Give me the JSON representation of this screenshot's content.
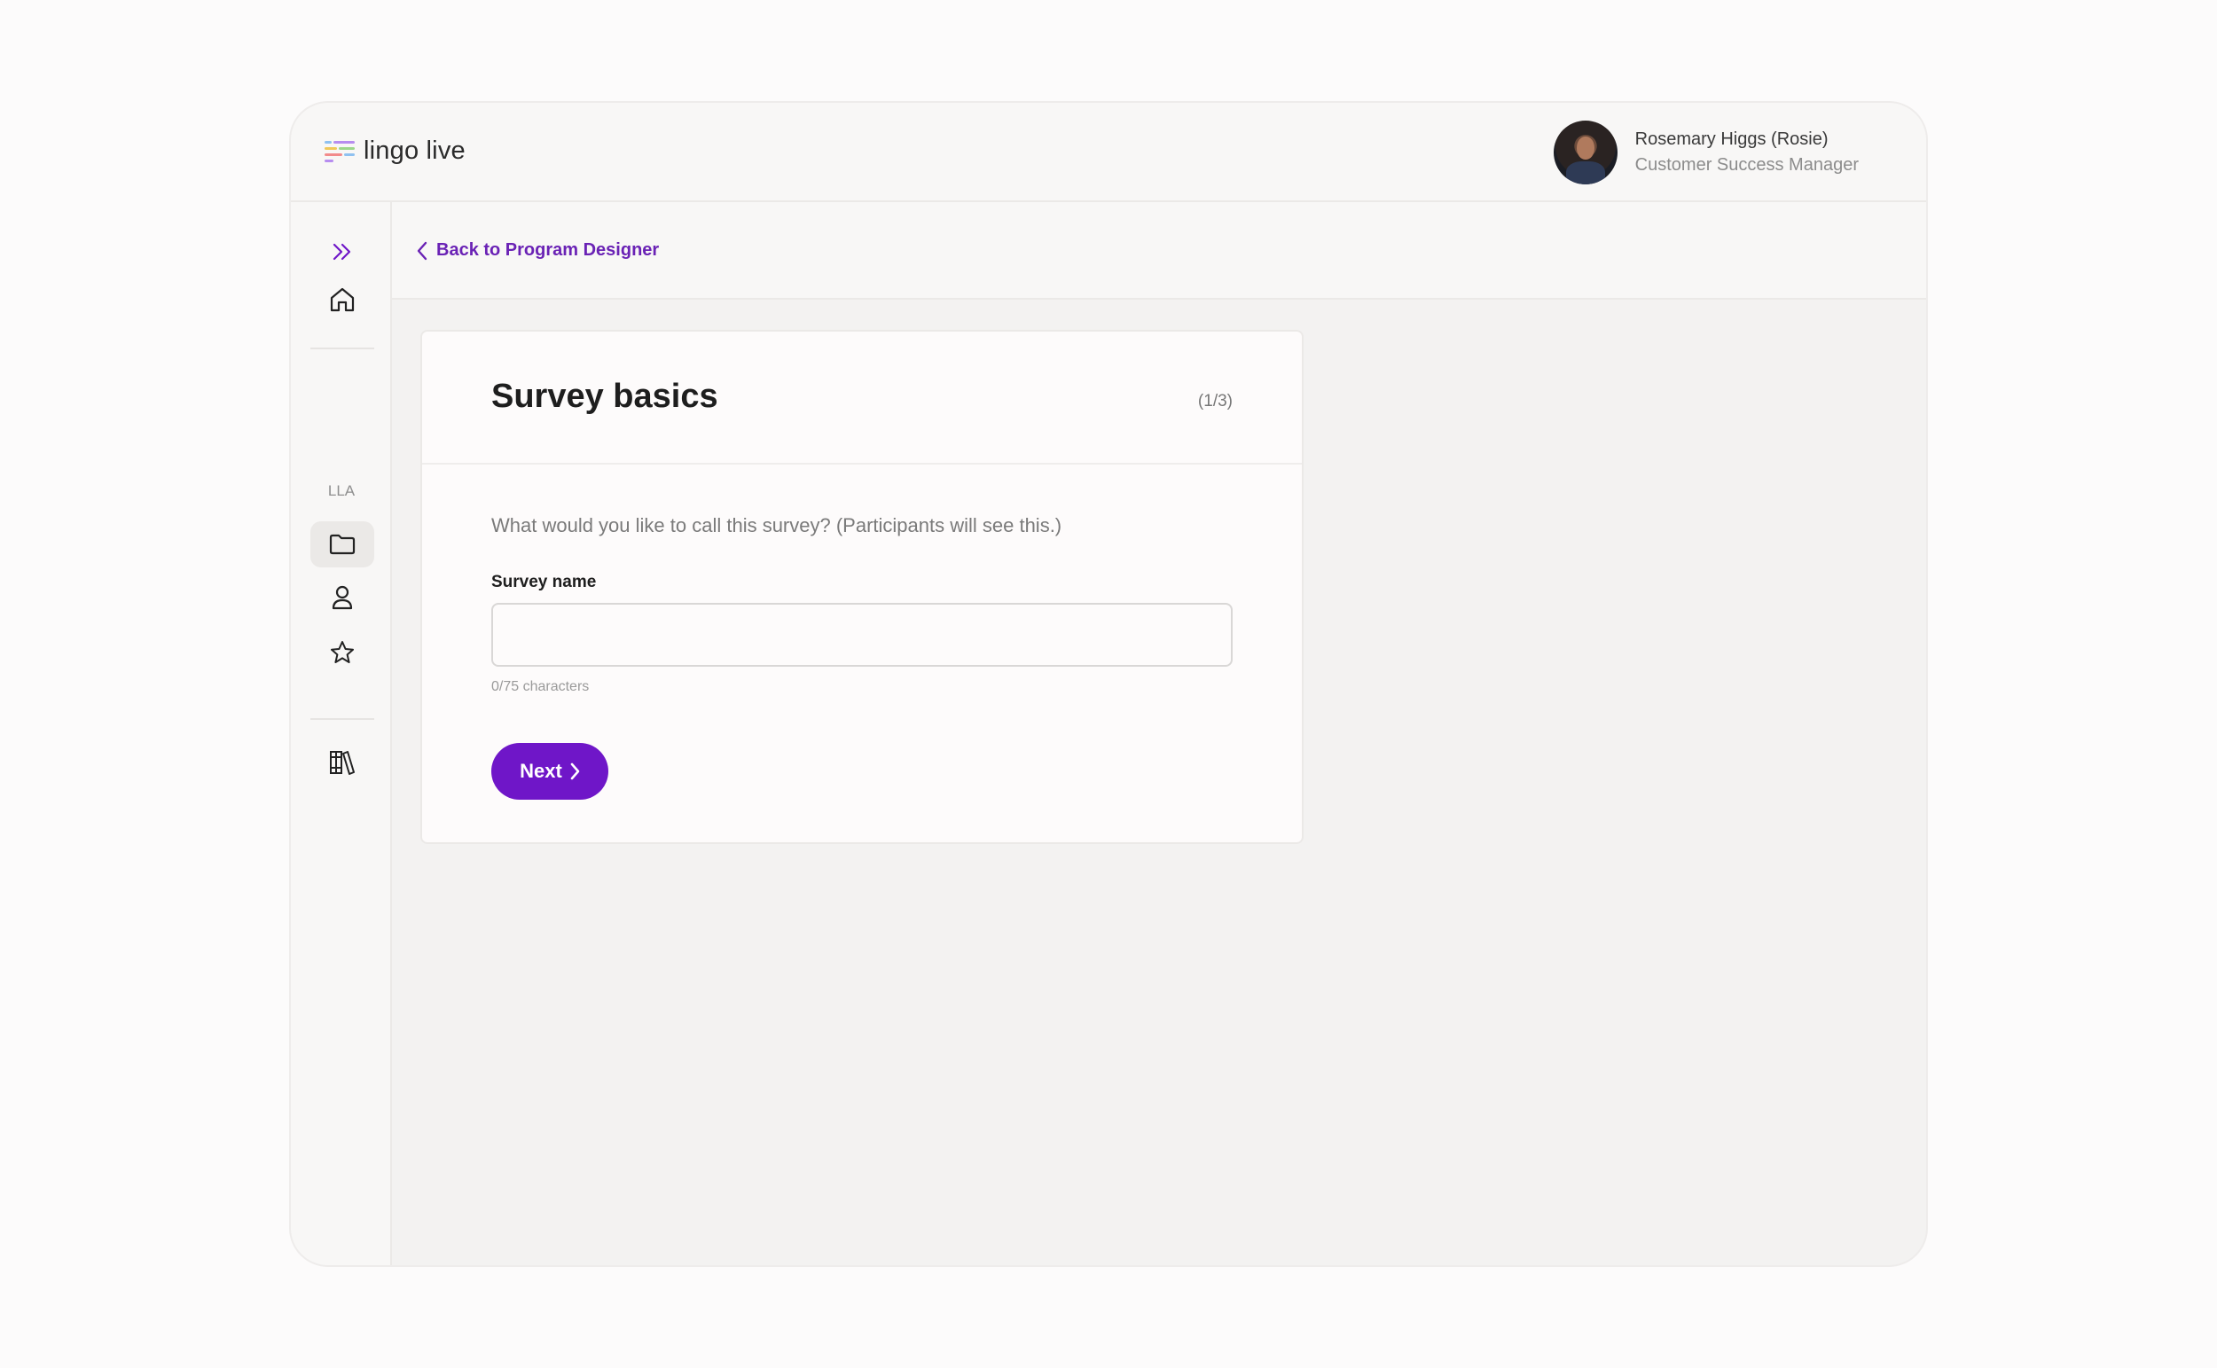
{
  "app": {
    "name": "lingo live"
  },
  "user": {
    "name": "Rosemary Higgs (Rosie)",
    "role": "Customer Success Manager"
  },
  "nav": {
    "section_label": "LLA",
    "icons": [
      "expand-icon",
      "home-icon",
      "folder-icon",
      "person-icon",
      "star-icon",
      "library-icon"
    ]
  },
  "subheader": {
    "back_label": "Back to Program Designer"
  },
  "card": {
    "title": "Survey basics",
    "step": "(1/3)",
    "question": "What would you like to call this survey? (Participants will see this.)",
    "field_label": "Survey name",
    "field_value": "",
    "field_placeholder": "",
    "hint": "0/75 characters",
    "next_label": "Next"
  },
  "colors": {
    "accent": "#6f16c8",
    "link": "#6a22b5",
    "background": "#f3f2f1"
  }
}
